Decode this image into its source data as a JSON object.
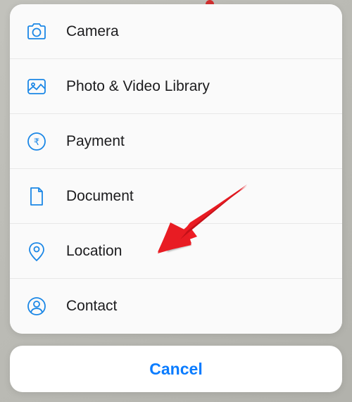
{
  "sheet": {
    "items": [
      {
        "icon": "camera-icon",
        "label": "Camera"
      },
      {
        "icon": "photo-icon",
        "label": "Photo & Video Library"
      },
      {
        "icon": "payment-icon",
        "label": "Payment"
      },
      {
        "icon": "document-icon",
        "label": "Document"
      },
      {
        "icon": "location-icon",
        "label": "Location"
      },
      {
        "icon": "contact-icon",
        "label": "Contact"
      }
    ]
  },
  "cancel": {
    "label": "Cancel"
  },
  "colors": {
    "accent": "#1b87e6",
    "text": "#1c1c1e",
    "cancel": "#0a7cff",
    "arrow": "#ed1c24"
  }
}
